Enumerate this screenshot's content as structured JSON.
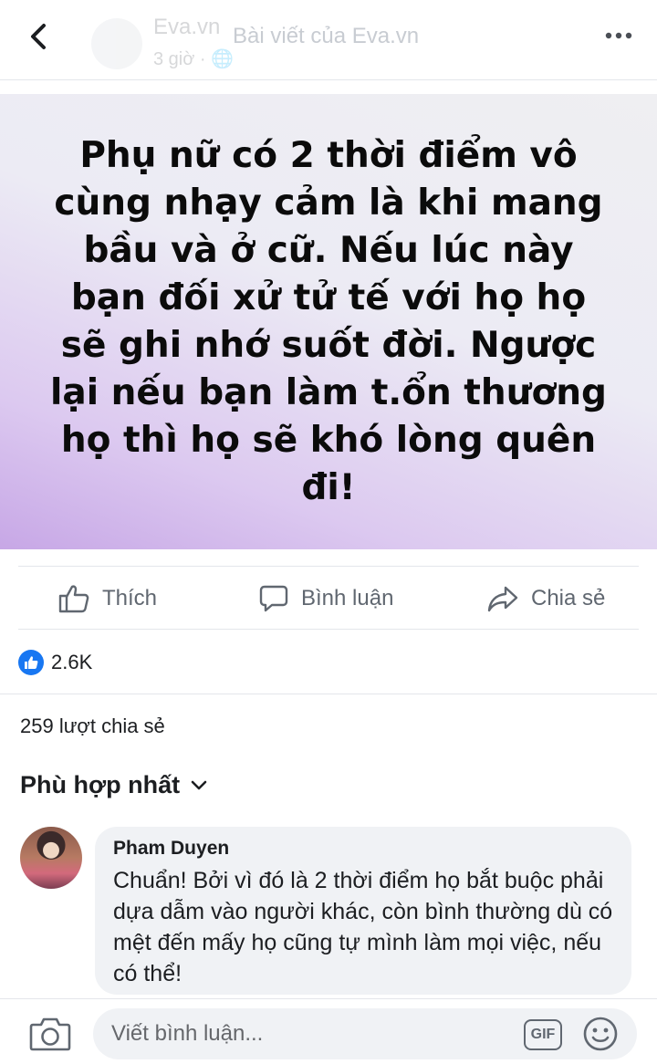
{
  "header": {
    "back_icon": "chevron-left-icon",
    "page_name": "Eva.vn",
    "page_meta": "3 giờ · 🌐",
    "title": "Bài viết của Eva.vn",
    "more_icon": "more-horizontal-icon"
  },
  "post": {
    "banner_text": "Phụ nữ có 2 thời điểm vô cùng nhạy cảm là khi mang bầu và ở cữ. Nếu lúc này bạn đối xử tử tế với họ họ sẽ ghi nhớ suốt đời. Ngược lại nếu bạn làm t.ổn thương họ thì họ sẽ khó lòng quên đi!",
    "banner_gradient": [
      "#c7a7e6",
      "#efeff2"
    ]
  },
  "actions": {
    "like_label": "Thích",
    "comment_label": "Bình luận",
    "share_label": "Chia sẻ"
  },
  "stats": {
    "reaction_count": "2.6K",
    "shares": "259 lượt chia sẻ"
  },
  "sort": {
    "label": "Phù hợp nhất"
  },
  "comments": [
    {
      "author": "Pham Duyen",
      "text": "Chuẩn! Bởi vì đó là 2 thời điểm họ bắt buộc phải dựa dẫm vào người khác, còn bình thường dù có mệt đến mấy họ cũng tự mình làm mọi việc, nếu có thể!"
    }
  ],
  "composer": {
    "placeholder": "Viết bình luận...",
    "gif_label": "GIF"
  },
  "colors": {
    "accent": "#1877f2",
    "icon_gray": "#606770",
    "bubble_bg": "#f0f2f5"
  }
}
